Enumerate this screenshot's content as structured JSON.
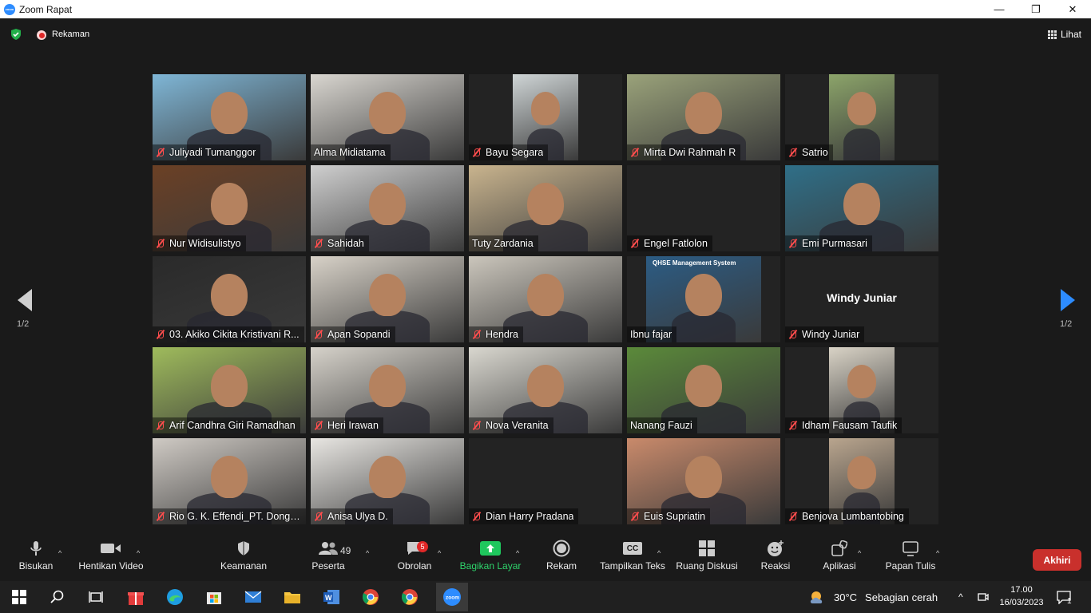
{
  "window": {
    "title": "Zoom Rapat",
    "logo_text": "zoom",
    "controls": {
      "minimize": "—",
      "restore": "❐",
      "close": "✕"
    }
  },
  "topbar": {
    "recording_label": "Rekaman",
    "view_label": "Lihat"
  },
  "pagination": {
    "left": "1/2",
    "right": "1/2"
  },
  "participants": [
    {
      "name": "Juliyadi Tumanggor",
      "muted": true,
      "bg": "#7fb6d6"
    },
    {
      "name": "Alma Midiatama",
      "muted": false,
      "bg": "#d9d6d0",
      "active": true
    },
    {
      "name": "Bayu Segara",
      "muted": true,
      "bg": "#cfd5d6"
    },
    {
      "name": "Mirta Dwi Rahmah R",
      "muted": true,
      "bg": "#9aa27a"
    },
    {
      "name": "Satrio",
      "muted": true,
      "bg": "#8ca46a"
    },
    {
      "name": "Nur Widisulistyo",
      "muted": true,
      "bg": "#6b4025"
    },
    {
      "name": "Sahidah",
      "muted": true,
      "bg": "#cfcfcf"
    },
    {
      "name": "Tuty Zardania",
      "muted": false,
      "bg": "#c9b48e"
    },
    {
      "name": "Engel Fatlolon",
      "muted": true,
      "bg": "#232323"
    },
    {
      "name": "Emi Purmasari",
      "muted": true,
      "bg": "#2f6f88"
    },
    {
      "name": "03. Akiko Cikita Kristivani R...",
      "muted": true,
      "bg": "#2a2a2a"
    },
    {
      "name": "Apan Sopandi",
      "muted": true,
      "bg": "#d8d2c8"
    },
    {
      "name": "Hendra",
      "muted": true,
      "bg": "#cbc6bc"
    },
    {
      "name": "Ibnu fajar",
      "muted": false,
      "bg": "#2c5c84",
      "banner": "QHSE Management System"
    },
    {
      "name": "Windy Juniar",
      "muted": true,
      "bg": "#232323",
      "big": "Windy Juniar"
    },
    {
      "name": "Arif Candhra Giri Ramadhan",
      "muted": true,
      "bg": "#9fbb5c"
    },
    {
      "name": "Heri Irawan",
      "muted": true,
      "bg": "#d6d2ca"
    },
    {
      "name": "Nova Veranita",
      "muted": true,
      "bg": "#d9d7cf"
    },
    {
      "name": "Nanang Fauzi",
      "muted": false,
      "bg": "#5b8a3a"
    },
    {
      "name": "Idham Fausam Taufik",
      "muted": true,
      "bg": "#d9d3c6"
    },
    {
      "name": "Rio G. K. Effendi_PT. Dongs...",
      "muted": true,
      "bg": "#cfcac4"
    },
    {
      "name": "Anisa Ulya D.",
      "muted": true,
      "bg": "#e8e6e2"
    },
    {
      "name": "Dian Harry Pradana",
      "muted": true,
      "bg": "#232323"
    },
    {
      "name": "Euis Supriatin",
      "muted": true,
      "bg": "#c98a6b"
    },
    {
      "name": "Benjova Lumbantobing",
      "muted": true,
      "bg": "#b9a58e"
    }
  ],
  "toolbar": {
    "mute": "Bisukan",
    "stop_video": "Hentikan Video",
    "security": "Keamanan",
    "participants": "Peserta",
    "participants_count": "49",
    "chat": "Obrolan",
    "chat_badge": "5",
    "share": "Bagikan Layar",
    "record": "Rekam",
    "captions": "Tampilkan Teks",
    "captions_icon": "CC",
    "breakout": "Ruang Diskusi",
    "reactions": "Reaksi",
    "apps": "Aplikasi",
    "whiteboard": "Papan Tulis",
    "end": "Akhiri"
  },
  "taskbar": {
    "weather_temp": "30°C",
    "weather_text": "Sebagian cerah",
    "time": "17.00",
    "date": "16/03/2023",
    "notif_count": "1"
  },
  "colors": {
    "accent_green": "#2ed36b",
    "end_red": "#c9302c",
    "active_speaker": "#e6e27a",
    "zoom_blue": "#2d8cff"
  }
}
